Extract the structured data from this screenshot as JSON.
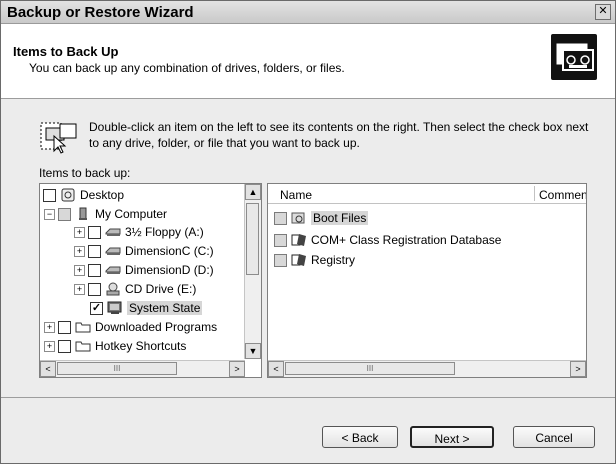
{
  "window": {
    "title": "Backup or Restore Wizard",
    "close_glyph": "✕"
  },
  "header": {
    "title": "Items to Back Up",
    "subtitle": "You can back up any combination of drives, folders, or files."
  },
  "hint": "Double-click an item on the left to see its contents on the right. Then select the check box next to any drive, folder, or file that you want to back up.",
  "items_label": "Items to back up:",
  "tree": {
    "items": [
      {
        "label": "Desktop",
        "icon": "desktop-icon",
        "checked": "unchecked"
      },
      {
        "label": "My Computer",
        "icon": "computer-icon",
        "checked": "partial",
        "expand": "−"
      },
      {
        "label": "3½ Floppy (A:)",
        "icon": "floppy-drive-icon",
        "checked": "unchecked",
        "expand": "+"
      },
      {
        "label": "DimensionC (C:)",
        "icon": "hard-drive-icon",
        "checked": "unchecked",
        "expand": "+"
      },
      {
        "label": "DimensionD (D:)",
        "icon": "hard-drive-icon",
        "checked": "unchecked",
        "expand": "+"
      },
      {
        "label": "CD Drive (E:)",
        "icon": "cd-drive-icon",
        "checked": "unchecked",
        "expand": "+"
      },
      {
        "label": "System State",
        "icon": "system-state-icon",
        "checked": "checked",
        "selected": true
      },
      {
        "label": "Downloaded Programs",
        "icon": "folder-icon",
        "checked": "unchecked",
        "expand": "+"
      },
      {
        "label": "Hotkey Shortcuts",
        "icon": "folder-icon",
        "checked": "unchecked",
        "expand": "+"
      }
    ]
  },
  "list": {
    "columns": [
      "Name",
      "Commen"
    ],
    "items": [
      {
        "label": "Boot Files",
        "icon": "boot-files-icon",
        "selected": true
      },
      {
        "label": "COM+ Class Registration Database",
        "icon": "component-icon"
      },
      {
        "label": "Registry",
        "icon": "registry-icon"
      }
    ]
  },
  "buttons": {
    "back": "< Back",
    "next": "Next >",
    "cancel": "Cancel"
  },
  "scroll_glyphs": {
    "up": "▲",
    "down": "▼",
    "left": "<",
    "right": ">",
    "grip": "III"
  }
}
